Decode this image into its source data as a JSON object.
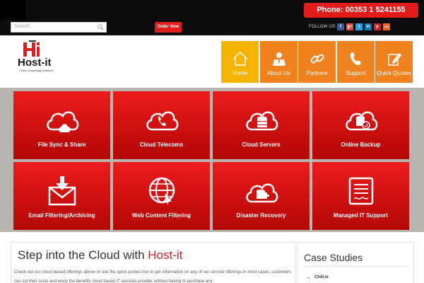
{
  "topbar": {
    "phone": "Phone: 00353 1 5241155",
    "search_placeholder": "Search",
    "order_now": "Order Now",
    "follow_us": "FOLLOW US:",
    "social": [
      {
        "icon": "facebook-icon",
        "glyph": "f",
        "color": "#3b5998"
      },
      {
        "icon": "google-plus-icon",
        "glyph": "g+",
        "color": "#dd4b39"
      },
      {
        "icon": "twitter-icon",
        "glyph": "t",
        "color": "#1da1f2"
      },
      {
        "icon": "linkedin-icon",
        "glyph": "in",
        "color": "#0077b5"
      },
      {
        "icon": "pinterest-icon",
        "glyph": "p",
        "color": "#cb2027"
      },
      {
        "icon": "rss-icon",
        "glyph": "rss",
        "color": "#f26522"
      }
    ]
  },
  "logo": {
    "name": "Host-it",
    "tagline": "Cloud Computing Solutions"
  },
  "nav": {
    "items": [
      {
        "label": "Home",
        "icon": "house-icon",
        "color": "#f5b400"
      },
      {
        "label": "About Us",
        "icon": "person-icon",
        "color": "#f0821e"
      },
      {
        "label": "Partners",
        "icon": "link-icon",
        "color": "#f0821e"
      },
      {
        "label": "Support",
        "icon": "phone-icon",
        "color": "#f0821e"
      },
      {
        "label": "Quick Quotes",
        "icon": "edit-icon",
        "color": "#f0821e"
      }
    ]
  },
  "services": [
    {
      "label": "File Sync & Share",
      "icon": "cloud-sync-icon"
    },
    {
      "label": "Cloud Telecoms",
      "icon": "cloud-phone-icon"
    },
    {
      "label": "Cloud Servers",
      "icon": "cloud-server-icon"
    },
    {
      "label": "Online Backup",
      "icon": "cloud-backup-icon"
    },
    {
      "label": "Email Filtering/Archiving",
      "icon": "email-download-icon"
    },
    {
      "label": "Web Content Filtering",
      "icon": "globe-icon"
    },
    {
      "label": "Disaster Recovery",
      "icon": "cloud-recovery-icon"
    },
    {
      "label": "Managed IT Support",
      "icon": "document-icon"
    }
  ],
  "main": {
    "heading_prefix": "Step into the Cloud with ",
    "heading_accent": "Host-it",
    "paragraph": "Check out our cloud based offerings above or use the quick quotes tool to get information on any of our service offerings.In most cases, customers can cut their costs and enjoy the benefits cloud based IT services provide, without having to purchase any"
  },
  "sidebar": {
    "title": "Case Studies",
    "items": [
      "Chill.ie"
    ]
  },
  "colors": {
    "brand_red": "#e31b1b",
    "nav_orange": "#f0821e",
    "nav_active": "#f5b400"
  }
}
